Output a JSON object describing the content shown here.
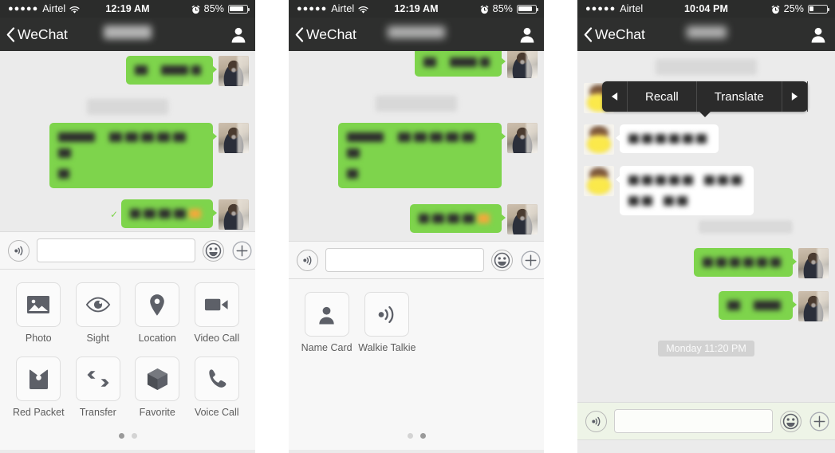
{
  "panels": [
    {
      "id": "panel-1",
      "status_bar": {
        "signal_dots": "●●●●●",
        "carrier": "Airtel",
        "wifi_icon": "wifi-icon",
        "time": "12:19 AM",
        "alarm_icon": "alarm-clock-icon",
        "battery_percent": "85%",
        "battery_level": 85
      },
      "nav_bar": {
        "back_label": "WeChat",
        "back_icon": "chevron-left-icon",
        "title": "",
        "contact_icon": "contact-profile-icon"
      },
      "messages": [
        {
          "side": "out",
          "kind": "blurred-text",
          "lines": [
            [
              16,
              10,
              34,
              12
            ]
          ],
          "avatar": "man-avatar"
        },
        {
          "side": "center",
          "kind": "time-divider",
          "text": ""
        },
        {
          "side": "out",
          "kind": "blurred-text",
          "lines": [
            [
              46,
              14,
              16,
              16,
              16,
              16,
              16,
              16
            ],
            [
              14
            ]
          ],
          "avatar": "man-avatar"
        },
        {
          "side": "out",
          "kind": "blurred-text",
          "read_tick": "✓",
          "lines": [
            [
              13,
              15,
              15,
              15,
              15
            ]
          ],
          "emoji": true,
          "avatar": "man-avatar"
        }
      ],
      "input_bar": {
        "voice_icon": "voice-input-icon",
        "field_value": "",
        "field_placeholder": "",
        "emoji_icon": "emoji-smiley-icon",
        "plus_icon": "plus-icon"
      },
      "attachment_panel": {
        "items": [
          {
            "label": "Photo",
            "icon": "photo-icon"
          },
          {
            "label": "Sight",
            "icon": "sight-eye-icon"
          },
          {
            "label": "Location",
            "icon": "location-pin-icon"
          },
          {
            "label": "Video Call",
            "icon": "video-camera-icon"
          },
          {
            "label": "Red Packet",
            "icon": "red-packet-icon"
          },
          {
            "label": "Transfer",
            "icon": "transfer-arrows-icon"
          },
          {
            "label": "Favorite",
            "icon": "favorite-cube-icon"
          },
          {
            "label": "Voice Call",
            "icon": "phone-handset-icon"
          }
        ],
        "page_count": 2,
        "active_page": 1
      }
    },
    {
      "id": "panel-2",
      "status_bar": {
        "signal_dots": "●●●●●",
        "carrier": "Airtel",
        "wifi_icon": "wifi-icon",
        "time": "12:19 AM",
        "alarm_icon": "alarm-clock-icon",
        "battery_percent": "85%",
        "battery_level": 85
      },
      "nav_bar": {
        "back_label": "WeChat",
        "back_icon": "chevron-left-icon",
        "title": "",
        "contact_icon": "contact-profile-icon"
      },
      "messages": [
        {
          "side": "out",
          "kind": "blurred-text",
          "lines": [
            [
              16,
              10,
              34,
              12
            ]
          ],
          "avatar": "man-avatar"
        },
        {
          "side": "center",
          "kind": "time-divider",
          "text": ""
        },
        {
          "side": "out",
          "kind": "blurred-text",
          "lines": [
            [
              46,
              14,
              16,
              16,
              16,
              16,
              16,
              16
            ],
            [
              14
            ]
          ],
          "avatar": "man-avatar"
        },
        {
          "side": "out",
          "kind": "blurred-text",
          "lines": [
            [
              13,
              15,
              15,
              15,
              15
            ]
          ],
          "emoji": true,
          "avatar": "man-avatar"
        }
      ],
      "input_bar": {
        "voice_icon": "voice-input-icon",
        "field_value": "",
        "field_placeholder": "",
        "emoji_icon": "emoji-smiley-icon",
        "plus_icon": "plus-icon"
      },
      "attachment_panel": {
        "items": [
          {
            "label": "Name Card",
            "icon": "name-card-icon"
          },
          {
            "label": "Walkie Talkie",
            "icon": "walkie-talkie-icon"
          }
        ],
        "page_count": 2,
        "active_page": 2
      }
    },
    {
      "id": "panel-3",
      "status_bar": {
        "signal_dots": "●●●●●",
        "carrier": "Airtel",
        "wifi_icon": "",
        "time": "10:04 PM",
        "alarm_icon": "alarm-clock-icon",
        "battery_percent": "25%",
        "battery_level": 25
      },
      "nav_bar": {
        "back_label": "WeChat",
        "back_icon": "chevron-left-icon",
        "title": "",
        "contact_icon": "contact-profile-icon"
      },
      "messages": [
        {
          "side": "center",
          "kind": "time-divider",
          "text": ""
        },
        {
          "side": "in",
          "kind": "blurred-text",
          "lines": [
            [
              13,
              13,
              13,
              13,
              13,
              13,
              13,
              13,
              13,
              8
            ]
          ],
          "avatar": "yellow-avatar"
        },
        {
          "side": "in",
          "kind": "blurred-text",
          "lines": [
            [
              13,
              13,
              13,
              13,
              13,
              13
            ]
          ],
          "avatar": "yellow-avatar"
        },
        {
          "side": "in",
          "kind": "blurred-text",
          "lines": [
            [
              13,
              13,
              13,
              13,
              13,
              13,
              13,
              13,
              13
            ],
            [
              13,
              13,
              13,
              13
            ]
          ],
          "avatar": "yellow-avatar"
        },
        {
          "side": "out",
          "kind": "blurred-text",
          "lines": [
            [
              13,
              13,
              13,
              13,
              13,
              13
            ]
          ],
          "avatar": "man-avatar"
        },
        {
          "side": "out",
          "kind": "blurred-text",
          "lines": [
            [
              16,
              10,
              34
            ]
          ],
          "avatar": "man-avatar"
        },
        {
          "side": "center",
          "kind": "time-stamp",
          "text": "Monday 11:20 PM"
        }
      ],
      "context_menu": {
        "prev_icon": "triangle-left-icon",
        "items": [
          {
            "label": "Recall"
          },
          {
            "label": "Translate"
          }
        ],
        "next_icon": "triangle-right-icon"
      },
      "input_bar": {
        "voice_icon": "voice-input-icon",
        "field_value": "",
        "field_placeholder": "",
        "emoji_icon": "emoji-smiley-icon",
        "plus_icon": "plus-icon"
      }
    }
  ],
  "colors": {
    "outgoing_bubble": "#7ed44c",
    "incoming_bubble": "#ffffff",
    "chat_background": "#ebebeb",
    "navbar": "#2e2f2e",
    "statusbar": "#2b2c2b",
    "context_menu": "#2b2b2b",
    "toolbar": "#f7f7f7",
    "toolbar_green_tint": "#eef4e7"
  }
}
